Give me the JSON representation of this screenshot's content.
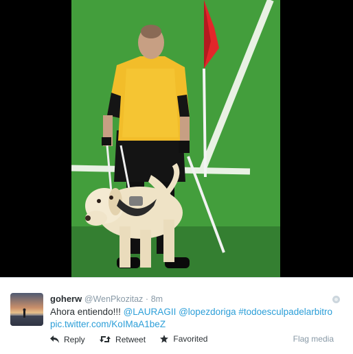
{
  "media": {
    "alt_shown": false
  },
  "tweet": {
    "fullname": "goherw",
    "handle": "@WenPkozitaz",
    "separator": "·",
    "time": "8m",
    "text_plain": "Ahora entiendo!!!",
    "mention1": "@LAURAGII",
    "mention2": "@lopezdoriga",
    "hashtag": "#todoesculpadelarbitro",
    "link": "pic.twitter.com/KoIMaA1beZ"
  },
  "actions": {
    "reply": "Reply",
    "retweet": "Retweet",
    "favorite": "Favorited",
    "flag": "Flag media"
  },
  "colors": {
    "link": "#2b9ed8",
    "text": "#292f33",
    "muted": "#8899a6"
  }
}
